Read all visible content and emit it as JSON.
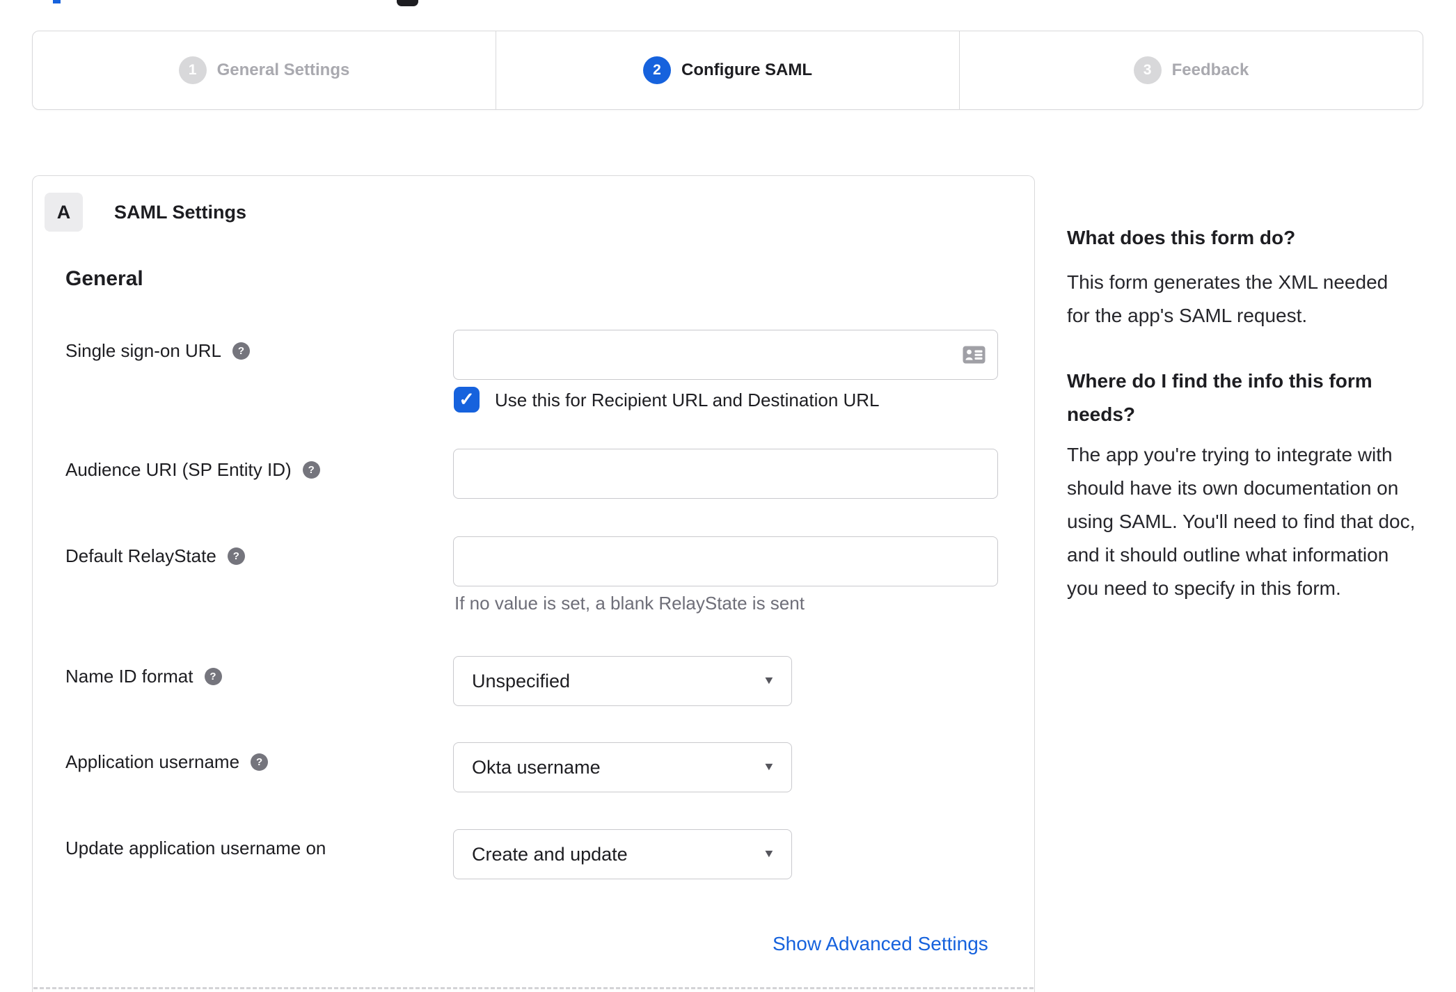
{
  "icons": {
    "help_glyph": "?",
    "check_glyph": "✓",
    "dropdown_arrow_glyph": "▼"
  },
  "colors": {
    "accent_blue": "#1662dd",
    "text_dark": "#1d1d21",
    "muted_grey": "#6e6e78",
    "inactive_step_grey": "#a9a9af",
    "border_grey": "#d9d9db"
  },
  "stepper": {
    "steps": [
      {
        "number": "1",
        "label": "General Settings",
        "state": "inactive"
      },
      {
        "number": "2",
        "label": "Configure SAML",
        "state": "active"
      },
      {
        "number": "3",
        "label": "Feedback",
        "state": "inactive"
      }
    ]
  },
  "panel": {
    "badge": "A",
    "title": "SAML Settings",
    "section_heading": "General",
    "fields": {
      "sso": {
        "label": "Single sign-on URL",
        "value": "",
        "checkbox_checked": true,
        "checkbox_label": "Use this for Recipient URL and Destination URL"
      },
      "audience": {
        "label": "Audience URI (SP Entity ID)",
        "value": ""
      },
      "relay": {
        "label": "Default RelayState",
        "value": "",
        "hint": "If no value is set, a blank RelayState is sent"
      },
      "name_id": {
        "label": "Name ID format",
        "value": "Unspecified"
      },
      "app_username": {
        "label": "Application username",
        "value": "Okta username"
      },
      "update_username": {
        "label": "Update application username on",
        "value": "Create and update"
      }
    },
    "advanced_link": "Show Advanced Settings"
  },
  "sidebar": {
    "q1_heading": "What does this form do?",
    "q1_body": "This form generates the XML needed for the app's SAML request.",
    "q2_heading": "Where do I find the info this form needs?",
    "q2_body": "The app you're trying to integrate with should have its own documentation on using SAML. You'll need to find that doc, and it should outline what information you need to specify in this form."
  }
}
